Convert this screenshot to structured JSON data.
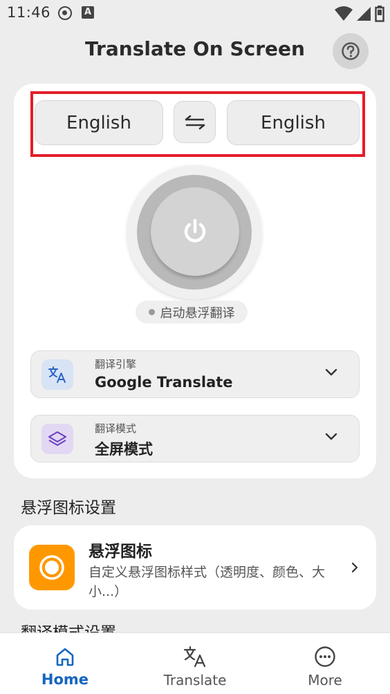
{
  "status_bar": {
    "time": "11:46",
    "icons": [
      "sync-icon",
      "font-icon",
      "wifi-icon",
      "signal-icon",
      "battery-icon"
    ],
    "font_icon_letter": "A"
  },
  "header": {
    "title": "Translate On Screen",
    "help_icon": "help-icon"
  },
  "translator": {
    "source_language": "English",
    "target_language": "English",
    "swap_icon": "swap-icon",
    "power_icon": "power-icon",
    "status_text": "启动悬浮翻译",
    "engine": {
      "caption": "翻译引擎",
      "value": "Google Translate",
      "icon": "translate-icon"
    },
    "mode": {
      "caption": "翻译模式",
      "value": "全屏模式",
      "icon": "layers-icon"
    }
  },
  "floating_icon_section": {
    "title": "悬浮图标设置",
    "card_title": "悬浮图标",
    "card_description": "自定义悬浮图标样式（透明度、颜色、大小...）",
    "icon": "circle-icon"
  },
  "next_section_title": "翻译模式设置",
  "bottom_nav": {
    "items": [
      {
        "label": "Home",
        "icon": "home-icon",
        "active": true
      },
      {
        "label": "Translate",
        "icon": "translate-icon",
        "active": false
      },
      {
        "label": "More",
        "icon": "more-icon",
        "active": false
      }
    ]
  },
  "colors": {
    "accent": "#1565c0",
    "highlight_border": "#e41e2a",
    "float_icon_bg": "#ff9800",
    "background": "#ededed"
  }
}
